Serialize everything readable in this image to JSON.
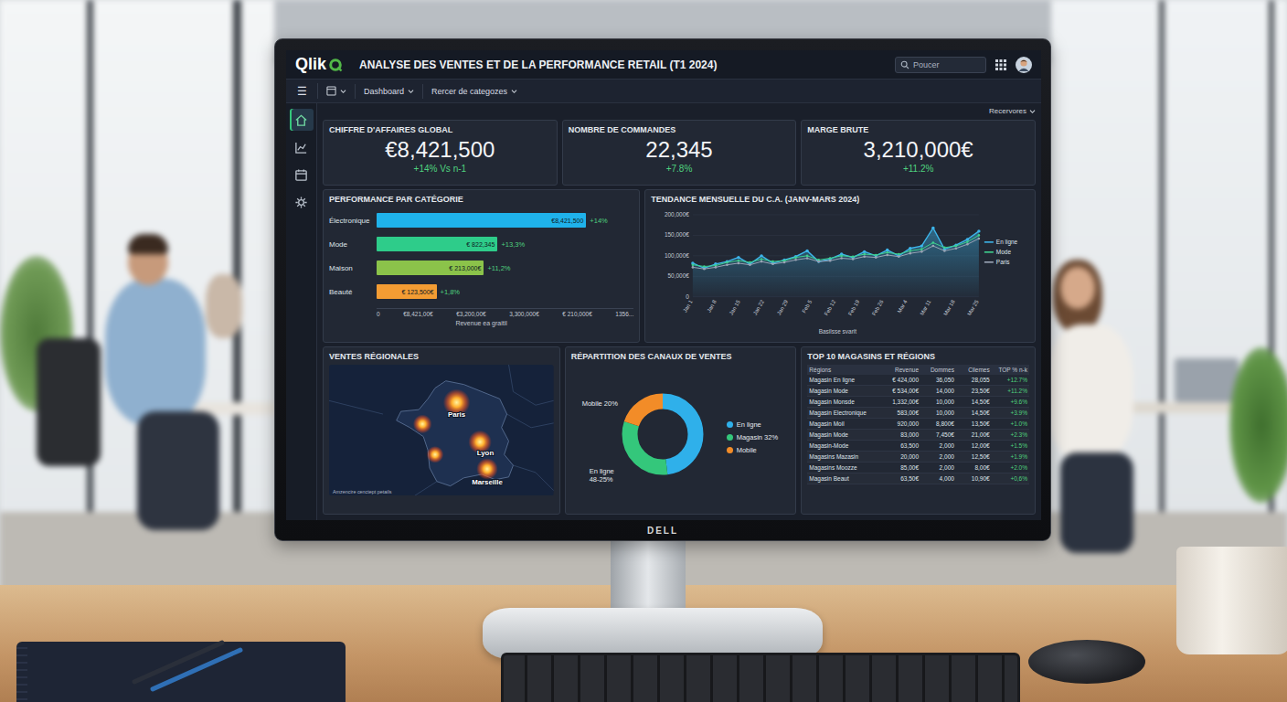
{
  "window": {
    "logo": "Qlik",
    "title": "ANALYSE DES VENTES ET DE LA PERFORMANCE RETAIL (T1 2024)"
  },
  "search": {
    "placeholder": "Poucer"
  },
  "toolbar": {
    "menu": "☰",
    "items": [
      {
        "label": "Dashboard"
      },
      {
        "label": "Rercer de categozes"
      }
    ],
    "right": "Recervores"
  },
  "sidebar": {
    "items": [
      {
        "selected": true
      },
      {
        "selected": false
      },
      {
        "selected": false
      },
      {
        "selected": false
      }
    ]
  },
  "kpis": [
    {
      "title": "CHIFFRE D'AFFAIRES GLOBAL",
      "value": "€8,421,500",
      "change": "+14% Vs n-1"
    },
    {
      "title": "NOMBRE DE COMMANDES",
      "value": "22,345",
      "change": "+7.8%"
    },
    {
      "title": "MARGE BRUTE",
      "value": "3,210,000€",
      "change": "+11.2%"
    }
  ],
  "category_chart": {
    "title": "PERFORMANCE PAR CATÉGORIE",
    "axis_max": 10.3,
    "bars": [
      {
        "label": "Électronique",
        "value": 8.4,
        "amount": "€8,421,500",
        "change": "+14%",
        "color": "#1fb2ea"
      },
      {
        "label": "Mode",
        "value": 4.85,
        "amount": "€ 822,345",
        "change": "+13,3%",
        "color": "#2ecc8a"
      },
      {
        "label": "Maison",
        "value": 4.3,
        "amount": "€ 213,000€",
        "change": "+11,2%",
        "color": "#8bc34a"
      },
      {
        "label": "Beauté",
        "value": 2.4,
        "amount": "€ 123,500€",
        "change": "+1,8%",
        "color": "#f39c33"
      }
    ],
    "ticks": [
      "0",
      "€8,421,00€",
      "€3,200,00€",
      "3,300,000€",
      "€ 210,000€",
      "1356..."
    ],
    "axis_title": "Revenue ea graitil"
  },
  "trend_chart": {
    "title": "TENDANCE MENSUELLE DU C.A. (JANV-MARS 2024)",
    "y_max": 200000,
    "y_ticks": [
      "200,000€",
      "150,000€",
      "100,000€",
      "50,000€",
      "0"
    ],
    "x_labels": [
      "Jan 1",
      "Jan 8",
      "Jan 15",
      "Jan 22",
      "Jan 29",
      "Feb 5",
      "Feb 12",
      "Feb 19",
      "Feb 26",
      "Mar 4",
      "Mar 11",
      "Mar 18",
      "Mar 25"
    ],
    "axis_title": "Basilsse svarit",
    "series": [
      {
        "name": "En ligne",
        "color": "#3db5ea",
        "values": [
          82000,
          70000,
          80000,
          86000,
          96000,
          80000,
          100000,
          82000,
          90000,
          98000,
          112000,
          86000,
          92000,
          104000,
          96000,
          110000,
          100000,
          114000,
          100000,
          118000,
          124000,
          168000,
          116000,
          126000,
          140000,
          160000
        ]
      },
      {
        "name": "Mode",
        "color": "#3fd08f",
        "values": [
          78000,
          74000,
          76000,
          84000,
          88000,
          84000,
          92000,
          86000,
          88000,
          96000,
          100000,
          90000,
          94000,
          100000,
          98000,
          104000,
          102000,
          108000,
          104000,
          112000,
          116000,
          132000,
          120000,
          124000,
          134000,
          150000
        ]
      },
      {
        "name": "Paris",
        "color": "#9aa4b5",
        "values": [
          72000,
          68000,
          72000,
          78000,
          82000,
          78000,
          86000,
          80000,
          84000,
          90000,
          94000,
          86000,
          88000,
          94000,
          92000,
          98000,
          96000,
          102000,
          98000,
          106000,
          110000,
          124000,
          112000,
          118000,
          128000,
          142000
        ]
      }
    ]
  },
  "regional_map": {
    "title": "VENTES RÉGIONALES",
    "cities": [
      {
        "label": "Paris",
        "level": 1
      },
      {
        "label": "Lyon",
        "level": 0.8
      },
      {
        "label": "Marseille",
        "level": 0.7
      }
    ],
    "extra_hotspots": [
      {
        "level": 0.55
      },
      {
        "level": 0.45
      }
    ],
    "footer": "Amzencire cenctept petails"
  },
  "channels_chart": {
    "title": "RÉPARTITION DES CANAUX DE VENTES",
    "segments": [
      {
        "legend": "En ligne",
        "share": 48,
        "color": "#2fb0ea"
      },
      {
        "legend": "Magasin 32%",
        "share": 32,
        "color": "#34c77b"
      },
      {
        "legend": "Mobile",
        "share": 20,
        "color": "#f28c28"
      }
    ],
    "callouts": [
      {
        "text": "Mobile 20%"
      },
      {
        "text": "En ligne 48-25%"
      }
    ]
  },
  "top_table": {
    "title": "TOP 10 MAGASINS ET RÉGIONS",
    "columns": [
      "Régions",
      "Revenue",
      "Dommes",
      "Cilemes",
      "TOP % n-k"
    ],
    "rows": [
      [
        "Magasin En ligne",
        "€ 424,000",
        "36,050",
        "28,055",
        "+12.7%"
      ],
      [
        "Magasin Mode",
        "€ 534,00€",
        "14,000",
        "23,50€",
        "+11.2%"
      ],
      [
        "Magasin Monsde",
        "1,332,00€",
        "10,000",
        "14,50€",
        "+9.6%"
      ],
      [
        "Magasin Electronique",
        "583,00€",
        "10,000",
        "14,50€",
        "+3.9%"
      ],
      [
        "Magasin Moil",
        "920,000",
        "8,800€",
        "13,50€",
        "+1.0%"
      ],
      [
        "Magasin Mode",
        "83,000",
        "7,450€",
        "21,00€",
        "+2.3%"
      ],
      [
        "Magasin-Mode",
        "63,500",
        "2,000",
        "12,00€",
        "+1.5%"
      ],
      [
        "Magasins Mazasin",
        "20,000",
        "2,000",
        "12,50€",
        "+1.9%"
      ],
      [
        "Magasins Moozze",
        "85,00€",
        "2,000",
        "8,00€",
        "+2.0%"
      ],
      [
        "Magasin Beaut",
        "63,50€",
        "4,000",
        "10,90€",
        "+0,6%"
      ]
    ]
  },
  "monitor": {
    "brand": "DELL"
  }
}
